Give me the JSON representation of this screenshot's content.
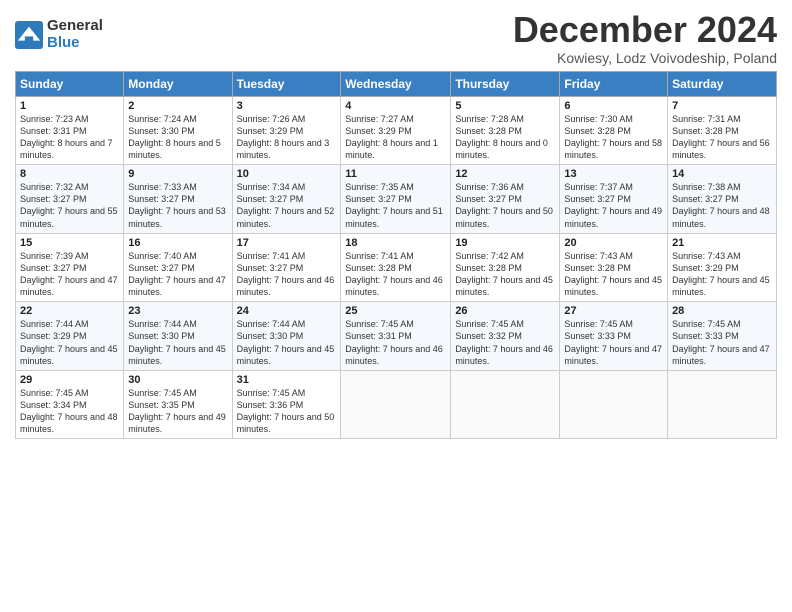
{
  "header": {
    "logo_general": "General",
    "logo_blue": "Blue",
    "title": "December 2024",
    "subtitle": "Kowiesy, Lodz Voivodeship, Poland"
  },
  "weekdays": [
    "Sunday",
    "Monday",
    "Tuesday",
    "Wednesday",
    "Thursday",
    "Friday",
    "Saturday"
  ],
  "weeks": [
    [
      {
        "day": "1",
        "sunrise": "Sunrise: 7:23 AM",
        "sunset": "Sunset: 3:31 PM",
        "daylight": "Daylight: 8 hours and 7 minutes."
      },
      {
        "day": "2",
        "sunrise": "Sunrise: 7:24 AM",
        "sunset": "Sunset: 3:30 PM",
        "daylight": "Daylight: 8 hours and 5 minutes."
      },
      {
        "day": "3",
        "sunrise": "Sunrise: 7:26 AM",
        "sunset": "Sunset: 3:29 PM",
        "daylight": "Daylight: 8 hours and 3 minutes."
      },
      {
        "day": "4",
        "sunrise": "Sunrise: 7:27 AM",
        "sunset": "Sunset: 3:29 PM",
        "daylight": "Daylight: 8 hours and 1 minute."
      },
      {
        "day": "5",
        "sunrise": "Sunrise: 7:28 AM",
        "sunset": "Sunset: 3:28 PM",
        "daylight": "Daylight: 8 hours and 0 minutes."
      },
      {
        "day": "6",
        "sunrise": "Sunrise: 7:30 AM",
        "sunset": "Sunset: 3:28 PM",
        "daylight": "Daylight: 7 hours and 58 minutes."
      },
      {
        "day": "7",
        "sunrise": "Sunrise: 7:31 AM",
        "sunset": "Sunset: 3:28 PM",
        "daylight": "Daylight: 7 hours and 56 minutes."
      }
    ],
    [
      {
        "day": "8",
        "sunrise": "Sunrise: 7:32 AM",
        "sunset": "Sunset: 3:27 PM",
        "daylight": "Daylight: 7 hours and 55 minutes."
      },
      {
        "day": "9",
        "sunrise": "Sunrise: 7:33 AM",
        "sunset": "Sunset: 3:27 PM",
        "daylight": "Daylight: 7 hours and 53 minutes."
      },
      {
        "day": "10",
        "sunrise": "Sunrise: 7:34 AM",
        "sunset": "Sunset: 3:27 PM",
        "daylight": "Daylight: 7 hours and 52 minutes."
      },
      {
        "day": "11",
        "sunrise": "Sunrise: 7:35 AM",
        "sunset": "Sunset: 3:27 PM",
        "daylight": "Daylight: 7 hours and 51 minutes."
      },
      {
        "day": "12",
        "sunrise": "Sunrise: 7:36 AM",
        "sunset": "Sunset: 3:27 PM",
        "daylight": "Daylight: 7 hours and 50 minutes."
      },
      {
        "day": "13",
        "sunrise": "Sunrise: 7:37 AM",
        "sunset": "Sunset: 3:27 PM",
        "daylight": "Daylight: 7 hours and 49 minutes."
      },
      {
        "day": "14",
        "sunrise": "Sunrise: 7:38 AM",
        "sunset": "Sunset: 3:27 PM",
        "daylight": "Daylight: 7 hours and 48 minutes."
      }
    ],
    [
      {
        "day": "15",
        "sunrise": "Sunrise: 7:39 AM",
        "sunset": "Sunset: 3:27 PM",
        "daylight": "Daylight: 7 hours and 47 minutes."
      },
      {
        "day": "16",
        "sunrise": "Sunrise: 7:40 AM",
        "sunset": "Sunset: 3:27 PM",
        "daylight": "Daylight: 7 hours and 47 minutes."
      },
      {
        "day": "17",
        "sunrise": "Sunrise: 7:41 AM",
        "sunset": "Sunset: 3:27 PM",
        "daylight": "Daylight: 7 hours and 46 minutes."
      },
      {
        "day": "18",
        "sunrise": "Sunrise: 7:41 AM",
        "sunset": "Sunset: 3:28 PM",
        "daylight": "Daylight: 7 hours and 46 minutes."
      },
      {
        "day": "19",
        "sunrise": "Sunrise: 7:42 AM",
        "sunset": "Sunset: 3:28 PM",
        "daylight": "Daylight: 7 hours and 45 minutes."
      },
      {
        "day": "20",
        "sunrise": "Sunrise: 7:43 AM",
        "sunset": "Sunset: 3:28 PM",
        "daylight": "Daylight: 7 hours and 45 minutes."
      },
      {
        "day": "21",
        "sunrise": "Sunrise: 7:43 AM",
        "sunset": "Sunset: 3:29 PM",
        "daylight": "Daylight: 7 hours and 45 minutes."
      }
    ],
    [
      {
        "day": "22",
        "sunrise": "Sunrise: 7:44 AM",
        "sunset": "Sunset: 3:29 PM",
        "daylight": "Daylight: 7 hours and 45 minutes."
      },
      {
        "day": "23",
        "sunrise": "Sunrise: 7:44 AM",
        "sunset": "Sunset: 3:30 PM",
        "daylight": "Daylight: 7 hours and 45 minutes."
      },
      {
        "day": "24",
        "sunrise": "Sunrise: 7:44 AM",
        "sunset": "Sunset: 3:30 PM",
        "daylight": "Daylight: 7 hours and 45 minutes."
      },
      {
        "day": "25",
        "sunrise": "Sunrise: 7:45 AM",
        "sunset": "Sunset: 3:31 PM",
        "daylight": "Daylight: 7 hours and 46 minutes."
      },
      {
        "day": "26",
        "sunrise": "Sunrise: 7:45 AM",
        "sunset": "Sunset: 3:32 PM",
        "daylight": "Daylight: 7 hours and 46 minutes."
      },
      {
        "day": "27",
        "sunrise": "Sunrise: 7:45 AM",
        "sunset": "Sunset: 3:33 PM",
        "daylight": "Daylight: 7 hours and 47 minutes."
      },
      {
        "day": "28",
        "sunrise": "Sunrise: 7:45 AM",
        "sunset": "Sunset: 3:33 PM",
        "daylight": "Daylight: 7 hours and 47 minutes."
      }
    ],
    [
      {
        "day": "29",
        "sunrise": "Sunrise: 7:45 AM",
        "sunset": "Sunset: 3:34 PM",
        "daylight": "Daylight: 7 hours and 48 minutes."
      },
      {
        "day": "30",
        "sunrise": "Sunrise: 7:45 AM",
        "sunset": "Sunset: 3:35 PM",
        "daylight": "Daylight: 7 hours and 49 minutes."
      },
      {
        "day": "31",
        "sunrise": "Sunrise: 7:45 AM",
        "sunset": "Sunset: 3:36 PM",
        "daylight": "Daylight: 7 hours and 50 minutes."
      },
      null,
      null,
      null,
      null
    ]
  ]
}
